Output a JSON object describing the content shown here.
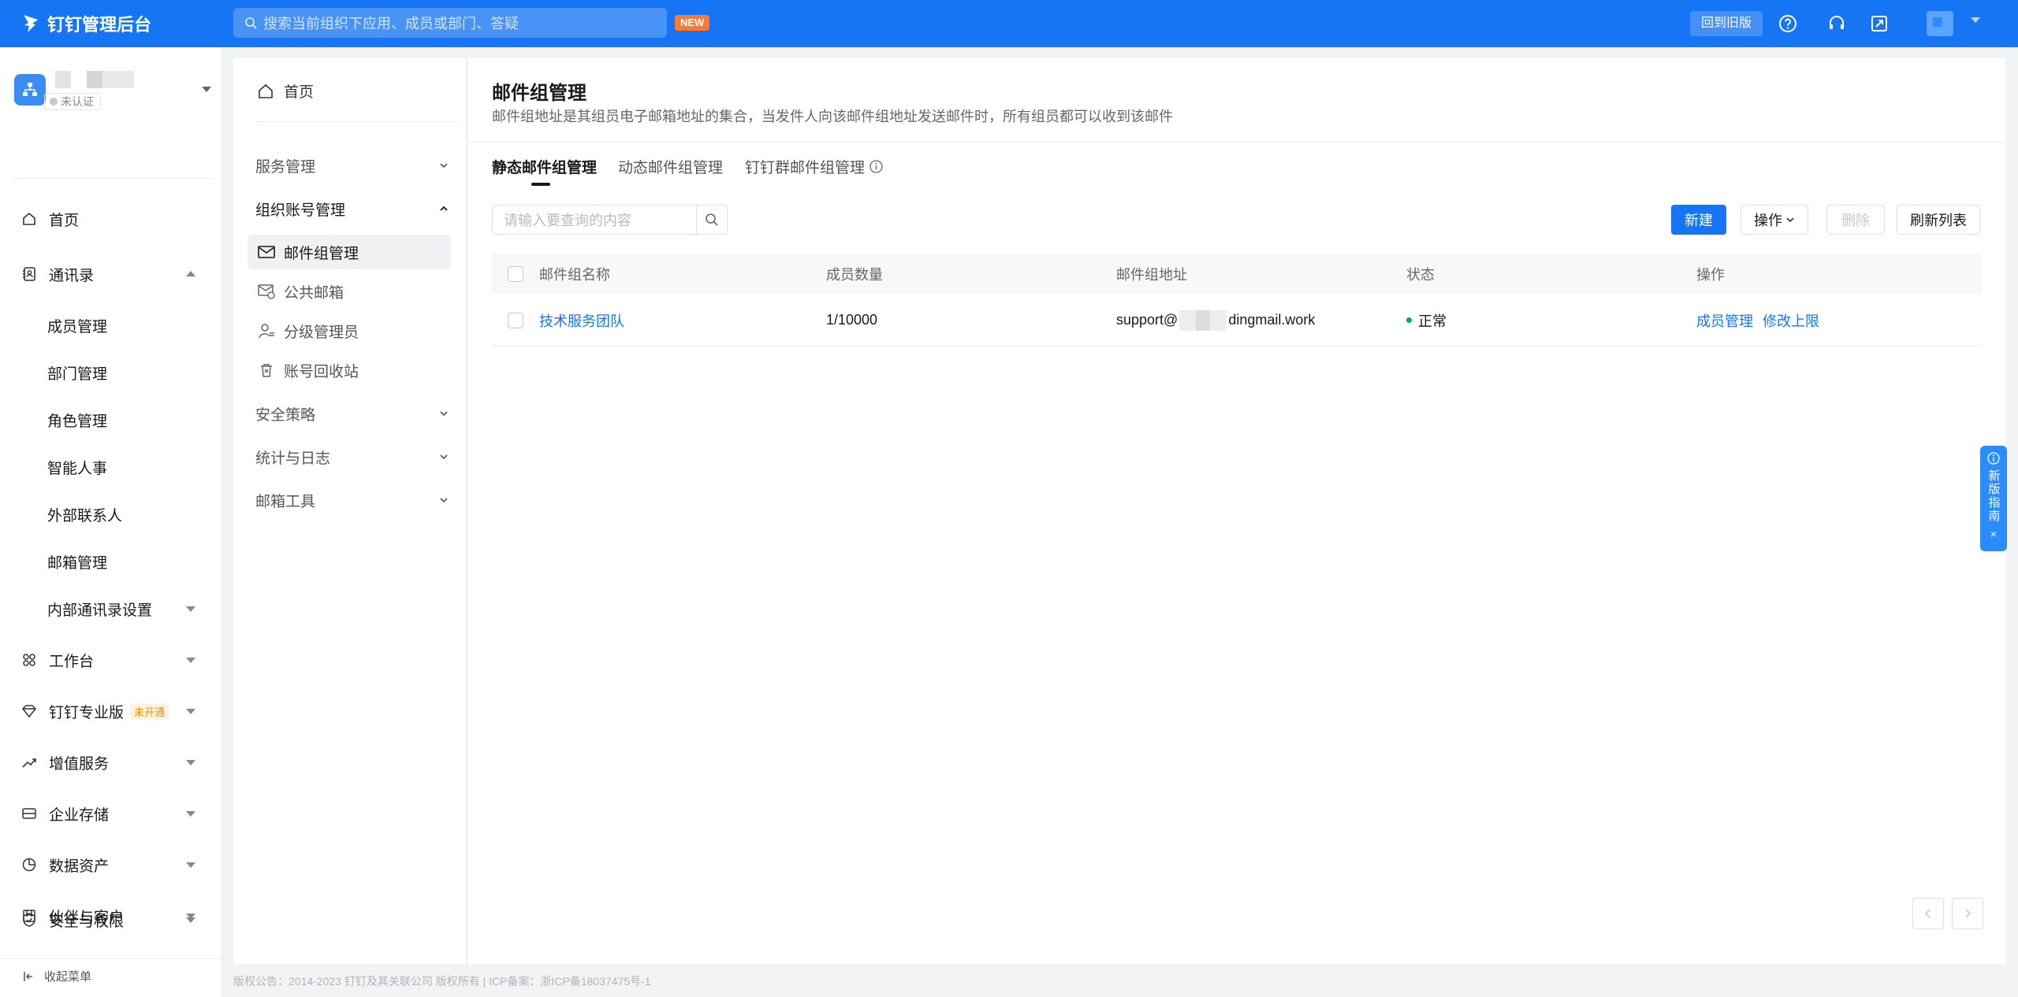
{
  "topbar": {
    "brand": "钉钉管理后台",
    "search_placeholder": "搜索当前组织下应用、成员或部门、答疑",
    "new_badge": "NEW",
    "back_old": "回到旧版"
  },
  "org": {
    "status": "未认证"
  },
  "sidebar": {
    "items": [
      {
        "label": "首页",
        "icon": "home-icon"
      },
      {
        "label": "通讯录",
        "icon": "contacts-icon"
      },
      {
        "label": "成员管理"
      },
      {
        "label": "部门管理"
      },
      {
        "label": "角色管理"
      },
      {
        "label": "智能人事"
      },
      {
        "label": "外部联系人"
      },
      {
        "label": "邮箱管理"
      },
      {
        "label": "内部通讯录设置"
      },
      {
        "label": "工作台",
        "icon": "workbench-icon"
      },
      {
        "label": "钉钉专业版",
        "icon": "diamond-icon",
        "badge": "未开通"
      },
      {
        "label": "增值服务",
        "icon": "trend-icon"
      },
      {
        "label": "企业存储",
        "icon": "storage-icon"
      },
      {
        "label": "数据资产",
        "icon": "data-icon"
      },
      {
        "label": "伙伴与客户",
        "icon": "partner-icon"
      },
      {
        "label": "安全与权限",
        "icon": "shield-icon"
      }
    ],
    "collapse": "收起菜单"
  },
  "subnav": {
    "home": "首页",
    "groups": [
      {
        "label": "服务管理"
      },
      {
        "label": "组织账号管理"
      },
      {
        "label": "安全策略"
      },
      {
        "label": "统计与日志"
      },
      {
        "label": "邮箱工具"
      }
    ],
    "items": [
      {
        "label": "邮件组管理"
      },
      {
        "label": "公共邮箱"
      },
      {
        "label": "分级管理员"
      },
      {
        "label": "账号回收站"
      }
    ]
  },
  "main": {
    "title": "邮件组管理",
    "desc": "邮件组地址是其组员电子邮箱地址的集合，当发件人向该邮件组地址发送邮件时，所有组员都可以收到该邮件",
    "tabs": [
      {
        "label": "静态邮件组管理"
      },
      {
        "label": "动态邮件组管理"
      },
      {
        "label": "钉钉群邮件组管理"
      }
    ],
    "query_placeholder": "请输入要查询的内容",
    "buttons": {
      "create": "新建",
      "ops": "操作",
      "delete": "删除",
      "refresh": "刷新列表"
    },
    "columns": [
      "邮件组名称",
      "成员数量",
      "邮件组地址",
      "状态",
      "操作"
    ],
    "rows": [
      {
        "name": "技术服务团队",
        "count": "1/10000",
        "addr_prefix": "support@",
        "addr_suffix": "dingmail.work",
        "status": "正常",
        "action1": "成员管理",
        "action2": "修改上限"
      }
    ]
  },
  "guide": {
    "text": "新版指南",
    "close": "×"
  },
  "footer": "版权公告：2014-2023 钉钉及其关联公司 版权所有 | ICP备案：浙ICP备18037475号-1",
  "colors": {
    "primary": "#1675f5",
    "status_ok": "#00b050",
    "badge_orange": "#ff7a2e"
  }
}
